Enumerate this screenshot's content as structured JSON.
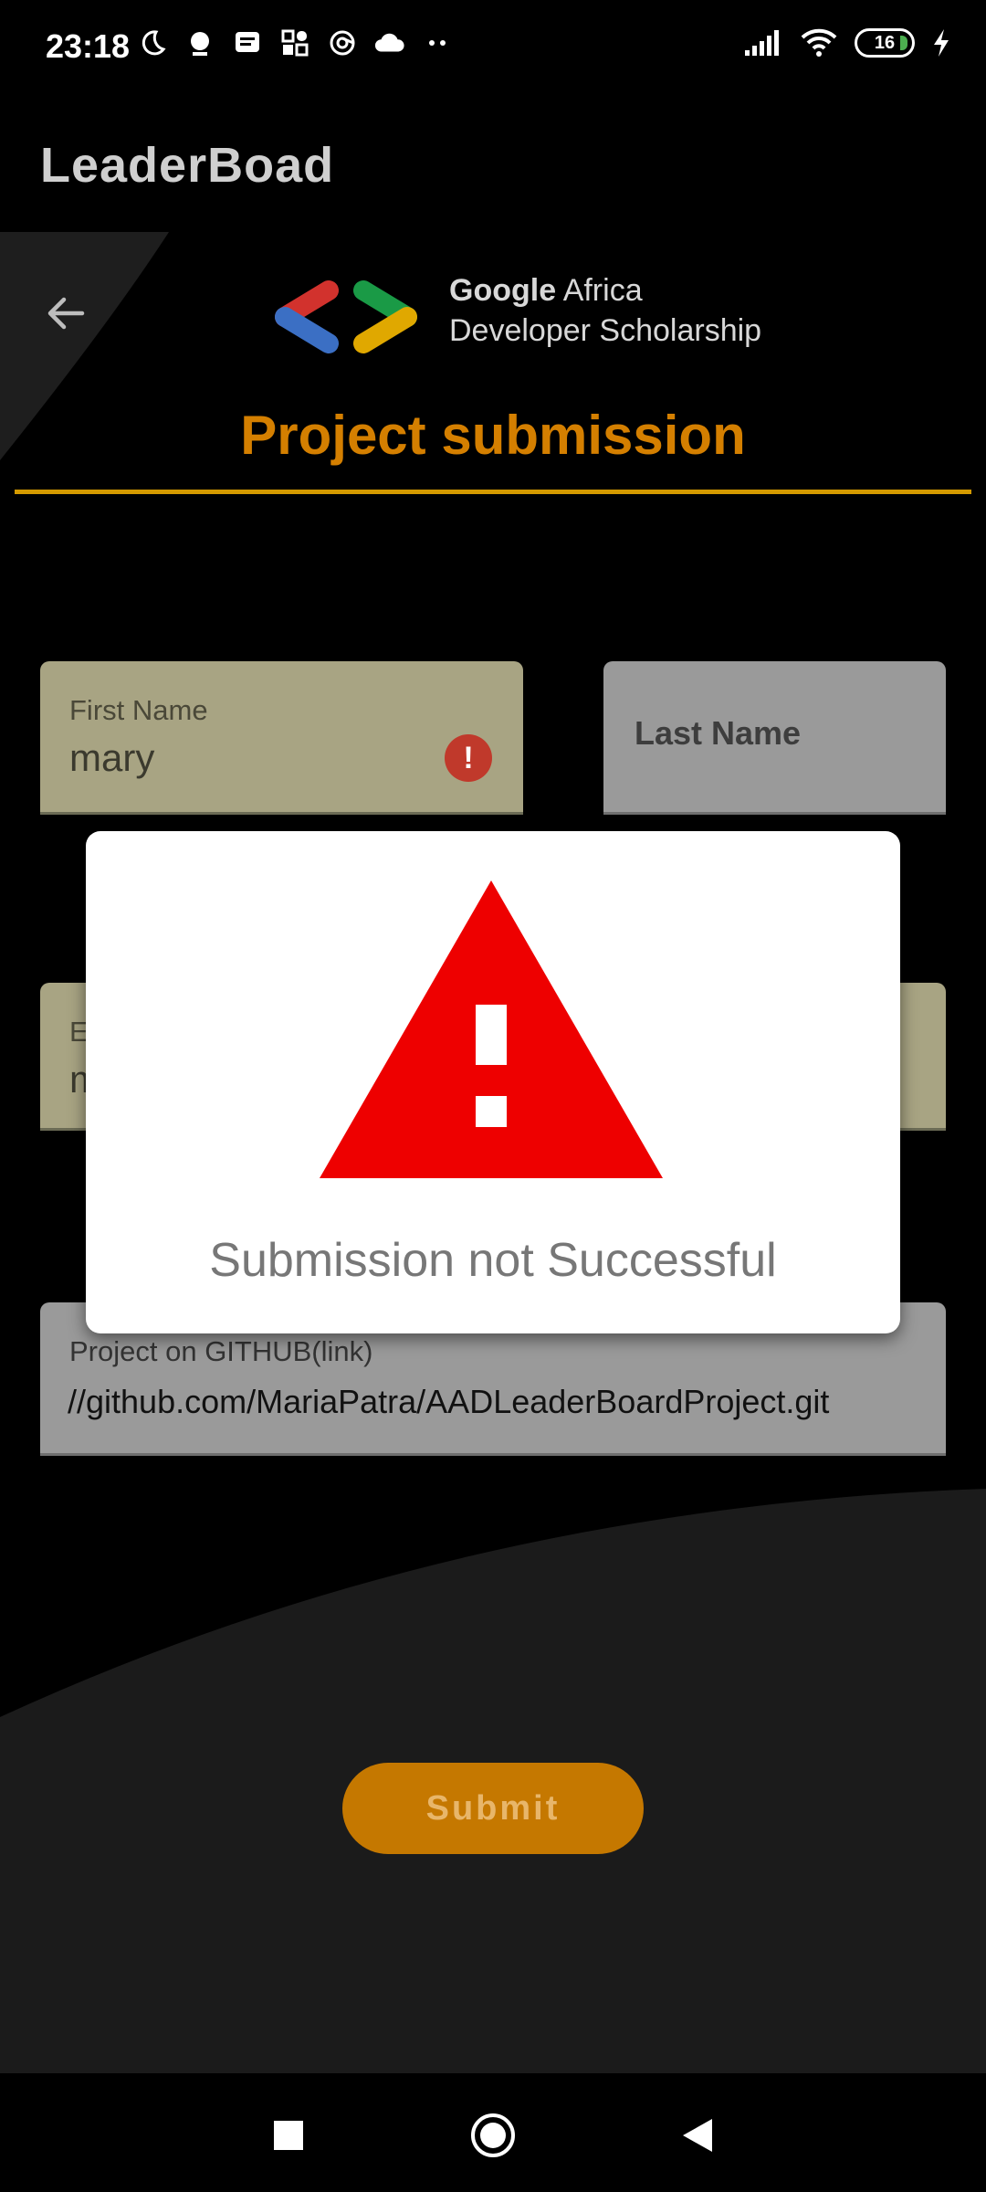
{
  "status_bar": {
    "time": "23:18",
    "battery_level": "16",
    "left_icons": [
      "moon-icon",
      "alarm-icon",
      "message-icon",
      "apps-icon",
      "sync-icon",
      "cloud-icon",
      "more-dots-icon"
    ],
    "right_icons": [
      "signal-icon",
      "wifi-icon",
      "battery-icon",
      "charging-icon"
    ]
  },
  "app_bar": {
    "title": "LeaderBoad"
  },
  "header": {
    "logo_text_brand": "Google",
    "logo_text_region": "Africa",
    "logo_text_line2": "Developer Scholarship",
    "title": "Project submission"
  },
  "form": {
    "first_name": {
      "label": "First Name",
      "value": "mary",
      "has_error": true
    },
    "last_name": {
      "placeholder": "Last Name"
    },
    "email": {
      "label": "E",
      "value": "m"
    },
    "github": {
      "label": "Project on GITHUB(link)",
      "value": "//github.com/MariaPatra/AADLeaderBoardProject.git"
    },
    "submit_label": "Submit"
  },
  "dialog": {
    "message": "Submission not Successful",
    "icon": "warning-icon"
  },
  "colors": {
    "accent": "#d47f00",
    "submit_bg": "#c57800",
    "field_tan": "#a8a483",
    "field_gray": "#9a9a9a",
    "warning_red": "#ee0000"
  }
}
